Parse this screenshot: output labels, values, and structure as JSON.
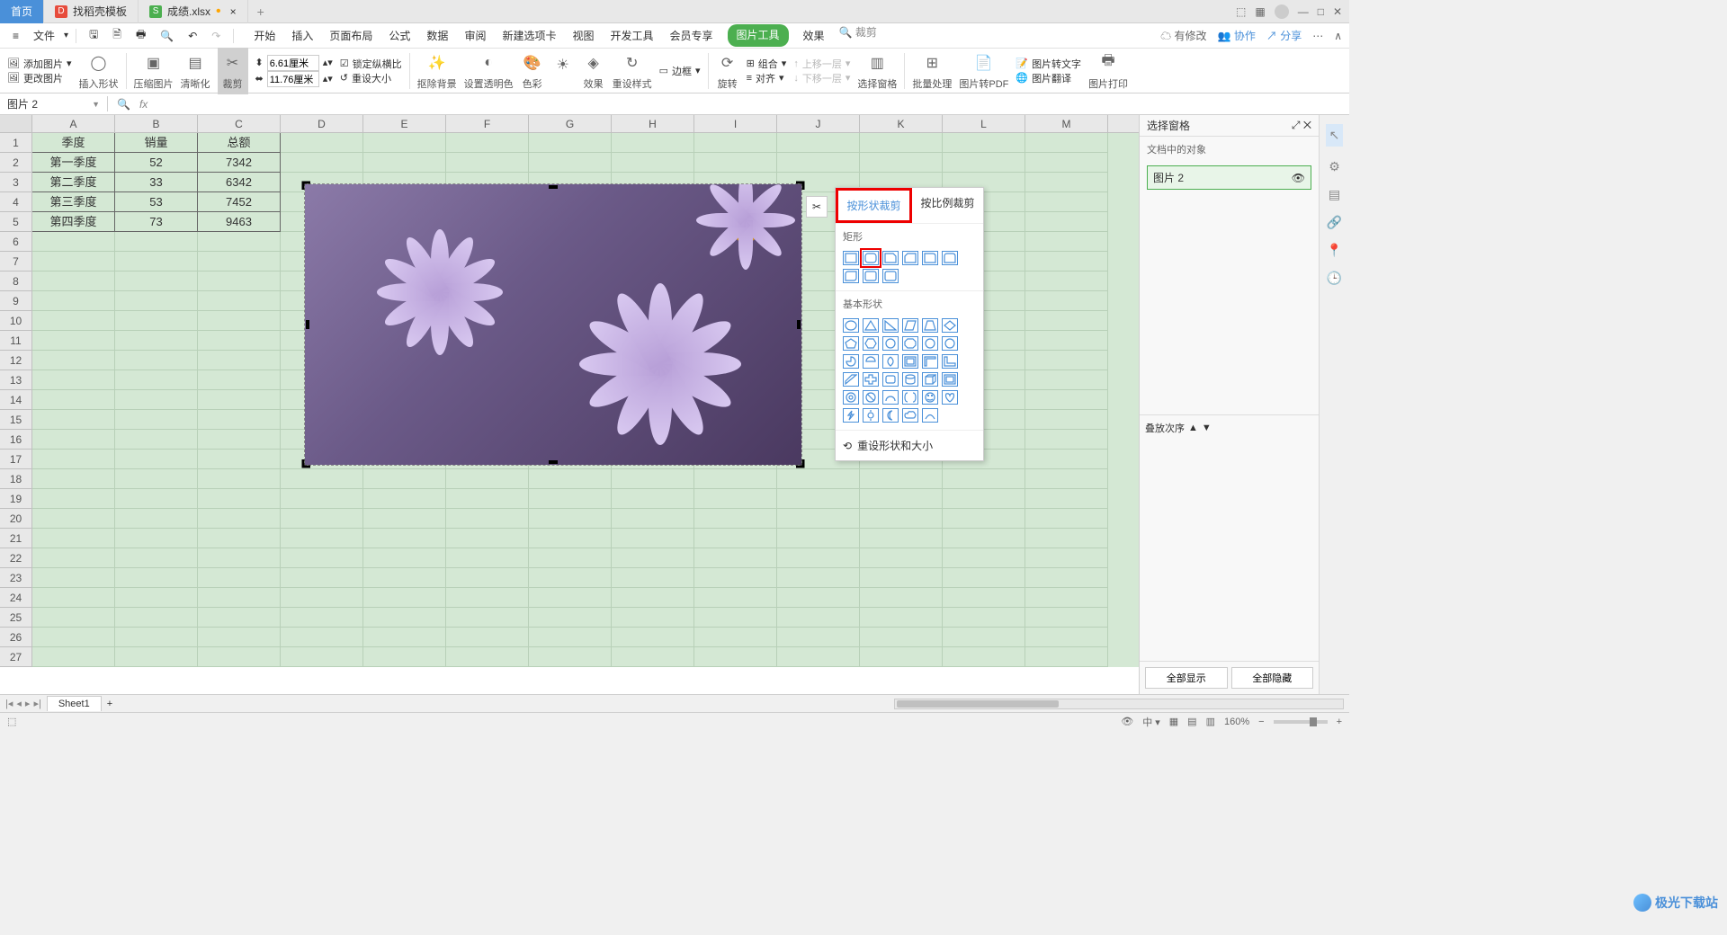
{
  "title_tabs": [
    {
      "label": "首页",
      "active": true
    },
    {
      "label": "找稻壳模板",
      "icon": "D",
      "active": false
    },
    {
      "label": "成绩.xlsx",
      "icon": "S",
      "modified": true,
      "active": false
    }
  ],
  "window_controls": {
    "min": "—",
    "max": "□",
    "close": "✕"
  },
  "menu": {
    "file": "文件",
    "tabs": [
      "开始",
      "插入",
      "页面布局",
      "公式",
      "数据",
      "审阅",
      "新建选项卡",
      "视图",
      "开发工具",
      "会员专享"
    ],
    "active_tab": "图片工具",
    "extra_tab": "效果",
    "search_placeholder": "裁剪",
    "right": {
      "changes": "有修改",
      "collab": "协作",
      "share": "分享"
    }
  },
  "ribbon": {
    "add_image": "添加图片",
    "change_image": "更改图片",
    "insert_shape": "插入形状",
    "compress": "压缩图片",
    "sharpen": "清晰化",
    "crop": "裁剪",
    "height": "6.61厘米",
    "width": "11.76厘米",
    "lock_ratio": "锁定纵横比",
    "reset_size": "重设大小",
    "remove_bg": "抠除背景",
    "transparency": "设置透明色",
    "color": "色彩",
    "effects": "效果",
    "reset_style": "重设样式",
    "border": "边框",
    "rotate": "旋转",
    "group": "组合",
    "align": "对齐",
    "up_layer": "上移一层",
    "down_layer": "下移一层",
    "select_pane": "选择窗格",
    "batch": "批量处理",
    "to_pdf": "图片转PDF",
    "to_text": "图片转文字",
    "translate": "图片翻译",
    "print": "图片打印"
  },
  "name_box": "图片 2",
  "columns": [
    "A",
    "B",
    "C",
    "D",
    "E",
    "F",
    "G",
    "H",
    "I",
    "J",
    "K",
    "L",
    "M"
  ],
  "row_count": 27,
  "table": {
    "headers": [
      "季度",
      "销量",
      "总额"
    ],
    "rows": [
      [
        "第一季度",
        "52",
        "7342"
      ],
      [
        "第二季度",
        "33",
        "6342"
      ],
      [
        "第三季度",
        "53",
        "7452"
      ],
      [
        "第四季度",
        "73",
        "9463"
      ]
    ]
  },
  "crop_popup": {
    "tab_shape": "按形状裁剪",
    "tab_ratio": "按比例裁剪",
    "section_rect": "矩形",
    "section_basic": "基本形状",
    "reset": "重设形状和大小"
  },
  "right_panel": {
    "title": "选择窗格",
    "subtitle": "文档中的对象",
    "item": "图片 2",
    "order": "叠放次序",
    "show_all": "全部显示",
    "hide_all": "全部隐藏"
  },
  "sheet_tab": "Sheet1",
  "status": {
    "zoom": "160%"
  }
}
